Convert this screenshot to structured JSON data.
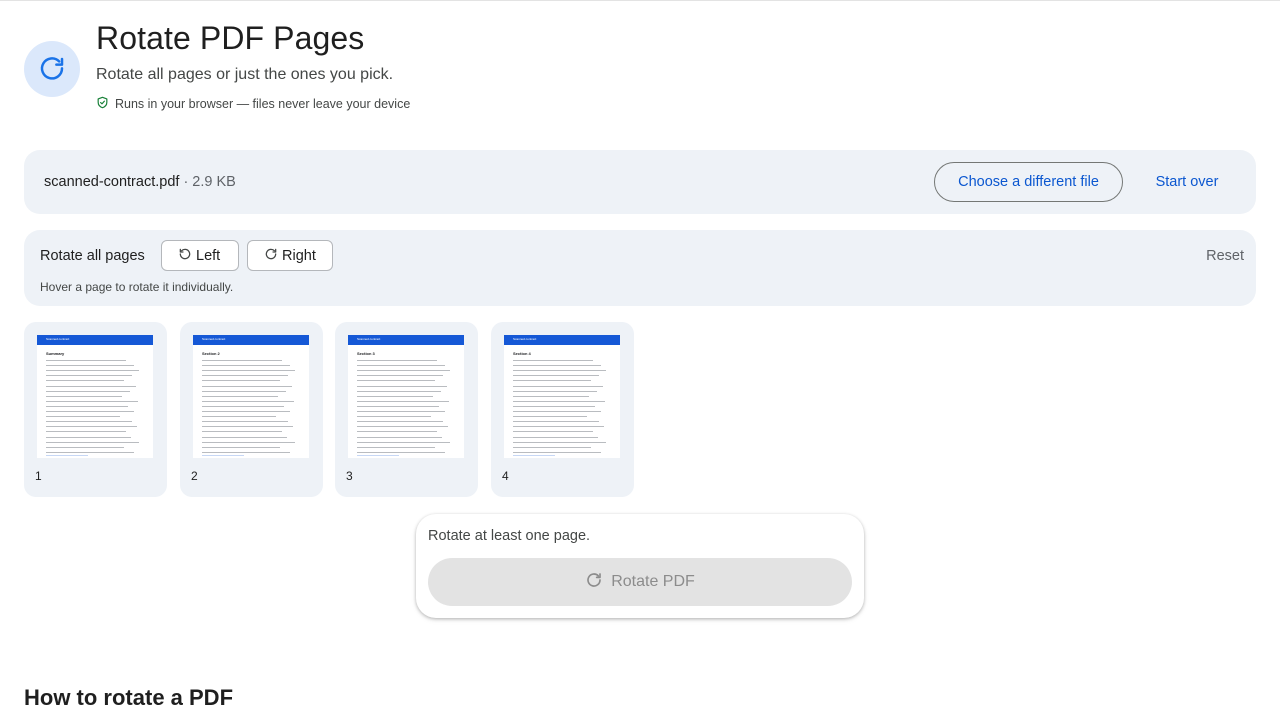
{
  "colors": {
    "accent": "#0b57d0",
    "panel": "#eef2f7",
    "icon_bg": "#dbe8fb",
    "disabled": "#e3e3e3"
  },
  "header": {
    "icon": "rotate-icon",
    "title": "Rotate PDF Pages",
    "subtitle": "Rotate all pages or just the ones you pick.",
    "privacy_icon": "shield-check-icon",
    "privacy_text": "Runs in your browser — files never leave your device"
  },
  "file": {
    "name": "scanned-contract.pdf",
    "size": " · 2.9 KB",
    "choose_label": "Choose a different file",
    "start_over_label": "Start over"
  },
  "rotate": {
    "all_label": "Rotate all pages",
    "left_label": "Left",
    "right_label": "Right",
    "reset_label": "Reset",
    "hint": "Hover a page to rotate it individually."
  },
  "pages": [
    {
      "number": "1",
      "header": "Scanned contract",
      "heading": "Summary"
    },
    {
      "number": "2",
      "header": "Scanned contract",
      "heading": "Section 2"
    },
    {
      "number": "3",
      "header": "Scanned contract",
      "heading": "Section 3"
    },
    {
      "number": "4",
      "header": "Scanned contract",
      "heading": "Section 4"
    }
  ],
  "action": {
    "hint": "Rotate at least one page.",
    "button_label": "Rotate PDF",
    "button_icon": "rotate-icon"
  },
  "howto": {
    "title": "How to rotate a PDF"
  }
}
